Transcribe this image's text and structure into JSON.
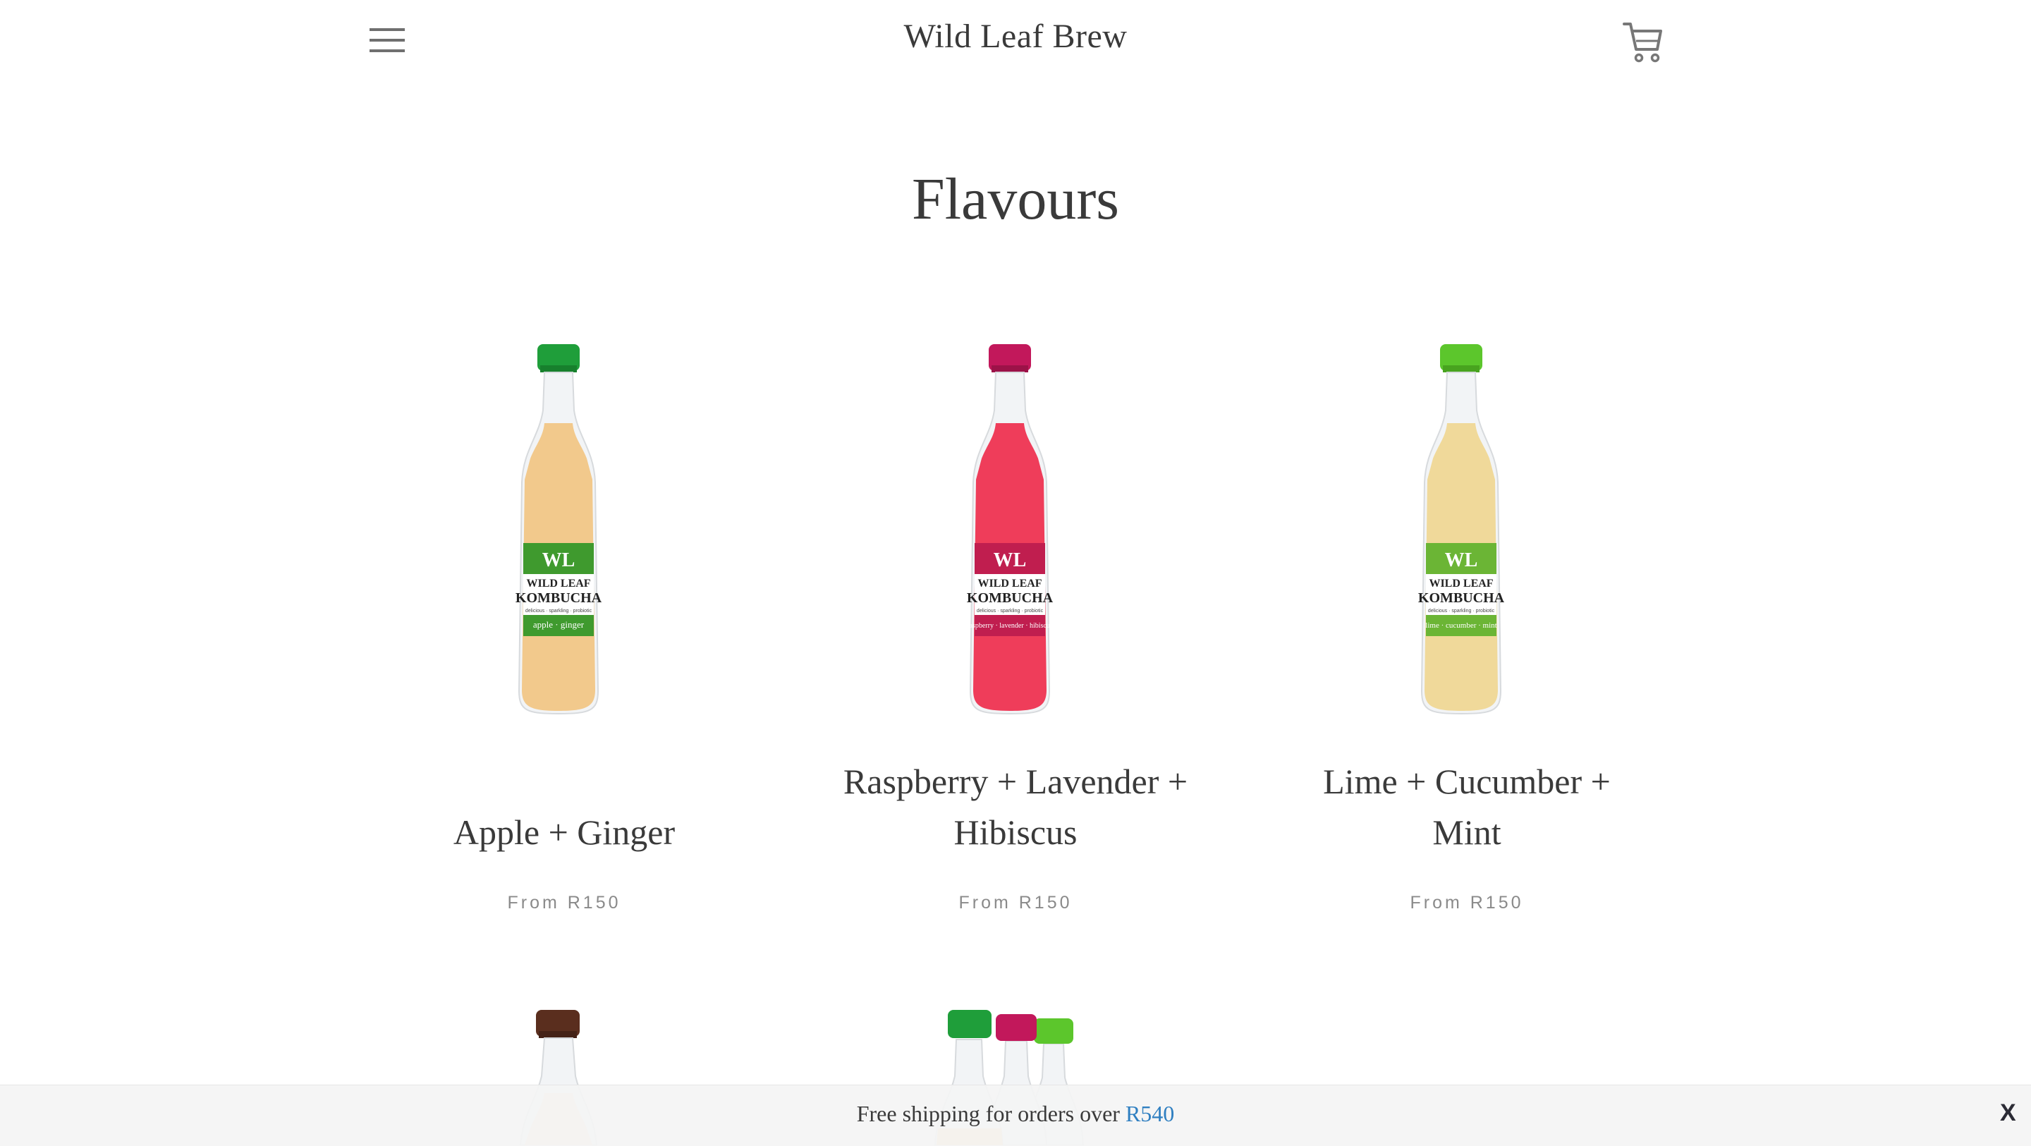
{
  "header": {
    "site_title": "Wild Leaf Brew",
    "menu_icon": "hamburger-menu-icon",
    "cart_icon": "shopping-cart-icon"
  },
  "page": {
    "title": "Flavours"
  },
  "products": [
    {
      "title_line1": "Apple + Ginger",
      "title_line2": "",
      "price": "From R150",
      "bottle_label": {
        "brand_line1": "WILD LEAF",
        "brand_line2": "KOMBUCHA",
        "tagline": "delicious · sparkling · probiotic",
        "flavour": "apple · ginger"
      },
      "colors": {
        "cap": "#1f9e3a",
        "liquid": "#f2c98c",
        "label": "#3f9a2e"
      }
    },
    {
      "title_line1": "Raspberry + Lavender +",
      "title_line2": "Hibiscus",
      "price": "From R150",
      "bottle_label": {
        "brand_line1": "WILD LEAF",
        "brand_line2": "KOMBUCHA",
        "tagline": "delicious · sparkling · probiotic",
        "flavour": "raspberry · lavender · hibiscus"
      },
      "colors": {
        "cap": "#c2185b",
        "liquid": "#ef3d5a",
        "label": "#c01e4f"
      }
    },
    {
      "title_line1": "Lime + Cucumber +",
      "title_line2": "Mint",
      "price": "From R150",
      "bottle_label": {
        "brand_line1": "WILD LEAF",
        "brand_line2": "KOMBUCHA",
        "tagline": "delicious · sparkling · probiotic",
        "flavour": "lime · cucumber · mint"
      },
      "colors": {
        "cap": "#5cc62c",
        "liquid": "#f0d99a",
        "label": "#6bb535"
      }
    }
  ],
  "partial_products": [
    {
      "colors": {
        "cap": "#5a2e1e",
        "liquid": "#f6e1c4"
      }
    },
    {
      "colors": {
        "caps": [
          "#1f9e3a",
          "#c2185b",
          "#5cc62c"
        ],
        "liquid": "#f4d58e"
      }
    }
  ],
  "banner": {
    "text": "Free shipping for orders over",
    "link": "R540",
    "close": "X"
  }
}
